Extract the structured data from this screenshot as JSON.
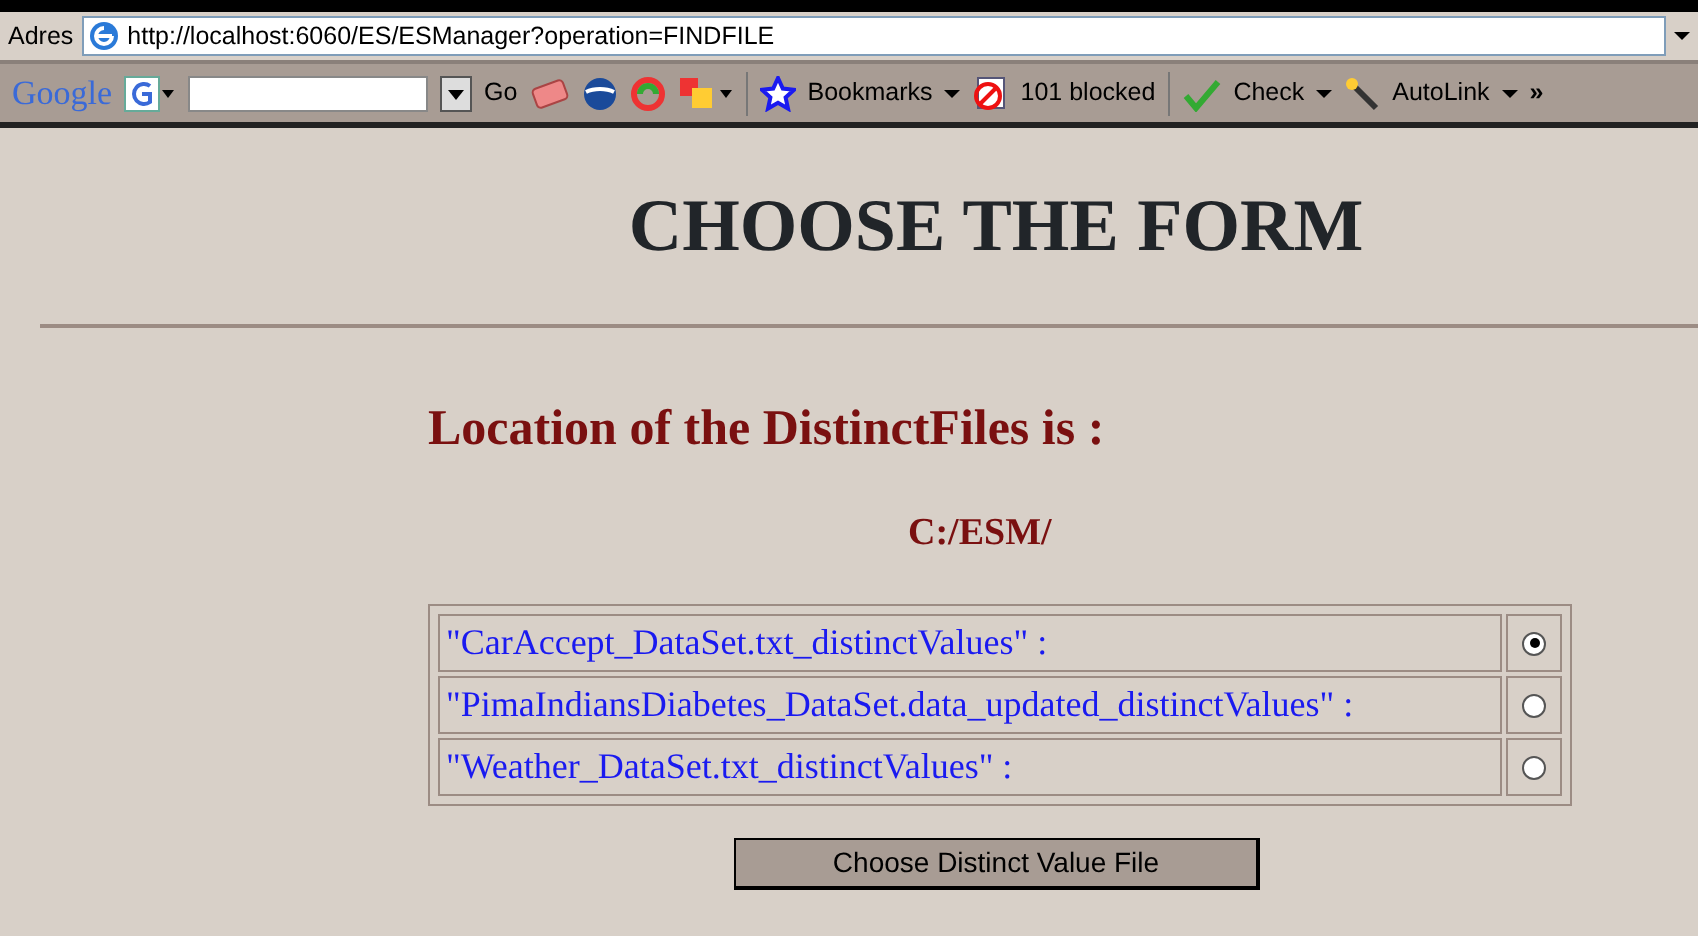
{
  "address_bar": {
    "label": "Adres",
    "url": "http://localhost:6060/ES/ESManager?operation=FINDFILE"
  },
  "toolbar": {
    "logo": "Google",
    "go": "Go",
    "bookmarks": "Bookmarks",
    "blocked": "101 blocked",
    "check": "Check",
    "autolink": "AutoLink",
    "more": "»"
  },
  "page": {
    "title": "CHOOSE THE FORM",
    "location_heading": "Location of the DistinctFiles is :",
    "path": "C:/ESM/",
    "files": [
      {
        "label": "\"CarAccept_DataSet.txt_distinctValues\" :",
        "selected": true
      },
      {
        "label": "\"PimaIndiansDiabetes_DataSet.data_updated_distinctValues\" :",
        "selected": false
      },
      {
        "label": "\"Weather_DataSet.txt_distinctValues\" :",
        "selected": false
      }
    ],
    "submit": "Choose Distinct Value File"
  }
}
